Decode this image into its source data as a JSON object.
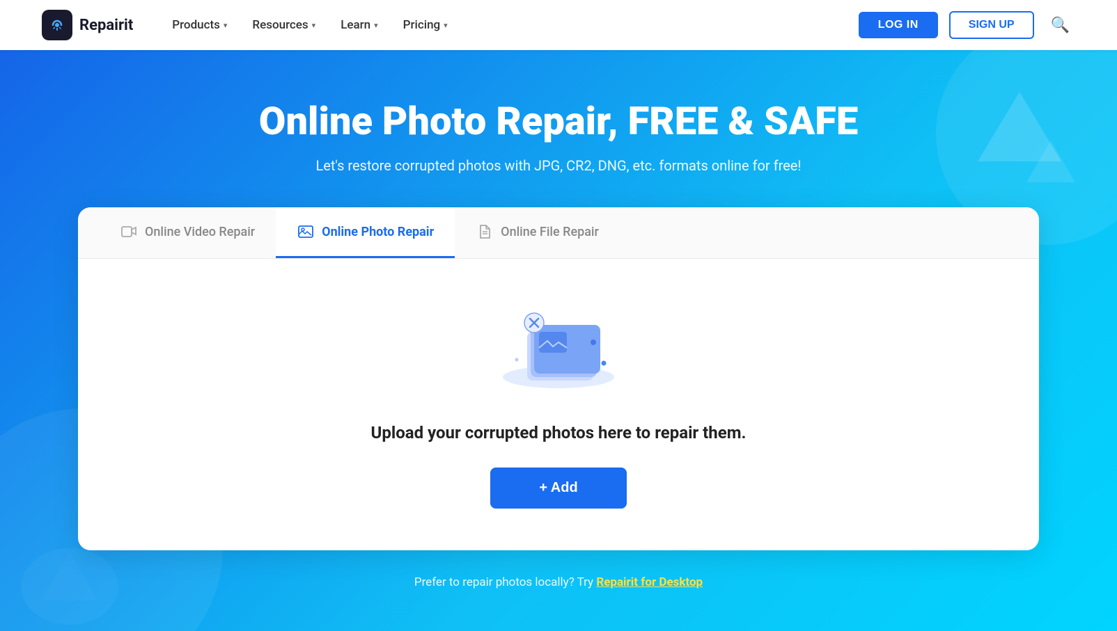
{
  "nav": {
    "logo_text": "Repairit",
    "items": [
      {
        "label": "Products",
        "has_chevron": true
      },
      {
        "label": "Resources",
        "has_chevron": true
      },
      {
        "label": "Learn",
        "has_chevron": true
      },
      {
        "label": "Pricing",
        "has_chevron": true
      }
    ],
    "login_label": "LOG IN",
    "signup_label": "SIGN UP"
  },
  "hero": {
    "title": "Online Photo Repair, FREE & SAFE",
    "subtitle": "Let's restore corrupted photos with JPG, CR2, DNG, etc. formats online for free!"
  },
  "tabs": [
    {
      "label": "Online Video Repair",
      "icon": "🎬",
      "active": false
    },
    {
      "label": "Online Photo Repair",
      "icon": "🖼",
      "active": true
    },
    {
      "label": "Online File Repair",
      "icon": "📄",
      "active": false
    }
  ],
  "card": {
    "upload_text": "Upload your corrupted photos here to repair them.",
    "add_button_label": "+ Add"
  },
  "footer_text": {
    "prefix": "Prefer to repair photos locally? Try ",
    "link_label": "Repairit for Desktop"
  }
}
